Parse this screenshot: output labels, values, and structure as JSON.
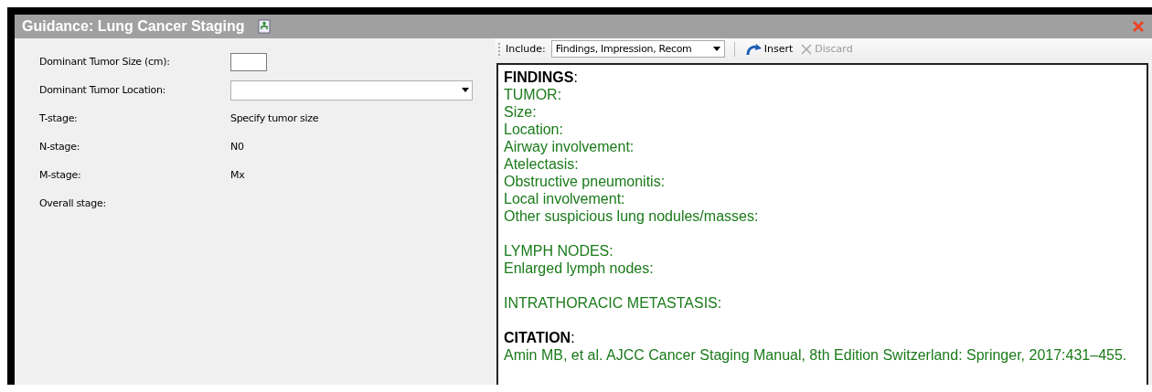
{
  "window": {
    "title": "Guidance: Lung Cancer Staging"
  },
  "form": [
    {
      "kind": "input",
      "label": "Dominant Tumor Size (cm):"
    },
    {
      "kind": "dropdown",
      "label": "Dominant Tumor Location:"
    },
    {
      "kind": "value",
      "label": "T-stage:",
      "value": "Specify tumor size"
    },
    {
      "kind": "value",
      "label": "N-stage:",
      "value": "N0"
    },
    {
      "kind": "value",
      "label": "M-stage:",
      "value": "Mx"
    },
    {
      "kind": "value",
      "label": "Overall stage:"
    }
  ],
  "toolbar": {
    "include_label": "Include:",
    "include_value": "Findings, Impression, Recom",
    "insert": {
      "label": "Insert",
      "disabled": false
    },
    "discard": {
      "label": "Discard",
      "disabled": true
    }
  },
  "report": [
    {
      "lines": [
        {
          "kind": "heading",
          "text": "**FINDINGS**:"
        },
        {
          "kind": "text",
          "text": "TUMOR:"
        },
        {
          "kind": "text",
          "text": "Size:"
        },
        {
          "kind": "text",
          "text": "Location:"
        },
        {
          "kind": "text",
          "text": "Airway involvement:"
        },
        {
          "kind": "text",
          "text": "Atelectasis:"
        },
        {
          "kind": "text",
          "text": "Obstructive pneumonitis:"
        },
        {
          "kind": "text",
          "text": "Local involvement:"
        },
        {
          "kind": "text",
          "text": "Other suspicious lung nodules/masses:"
        }
      ]
    },
    {
      "lines": [
        {
          "kind": "text",
          "text": "LYMPH NODES:"
        },
        {
          "kind": "text",
          "text": "Enlarged lymph nodes:"
        }
      ]
    },
    {
      "lines": [
        {
          "kind": "text",
          "text": "INTRATHORACIC METASTASIS:"
        }
      ]
    },
    {
      "lines": [
        {
          "kind": "heading",
          "text": "**CITATION**:"
        },
        {
          "kind": "text",
          "text": "Amin MB, et al. AJCC Cancer Staging Manual, 8th Edition Switzerland: Springer, 2017:431–455."
        }
      ]
    }
  ]
}
